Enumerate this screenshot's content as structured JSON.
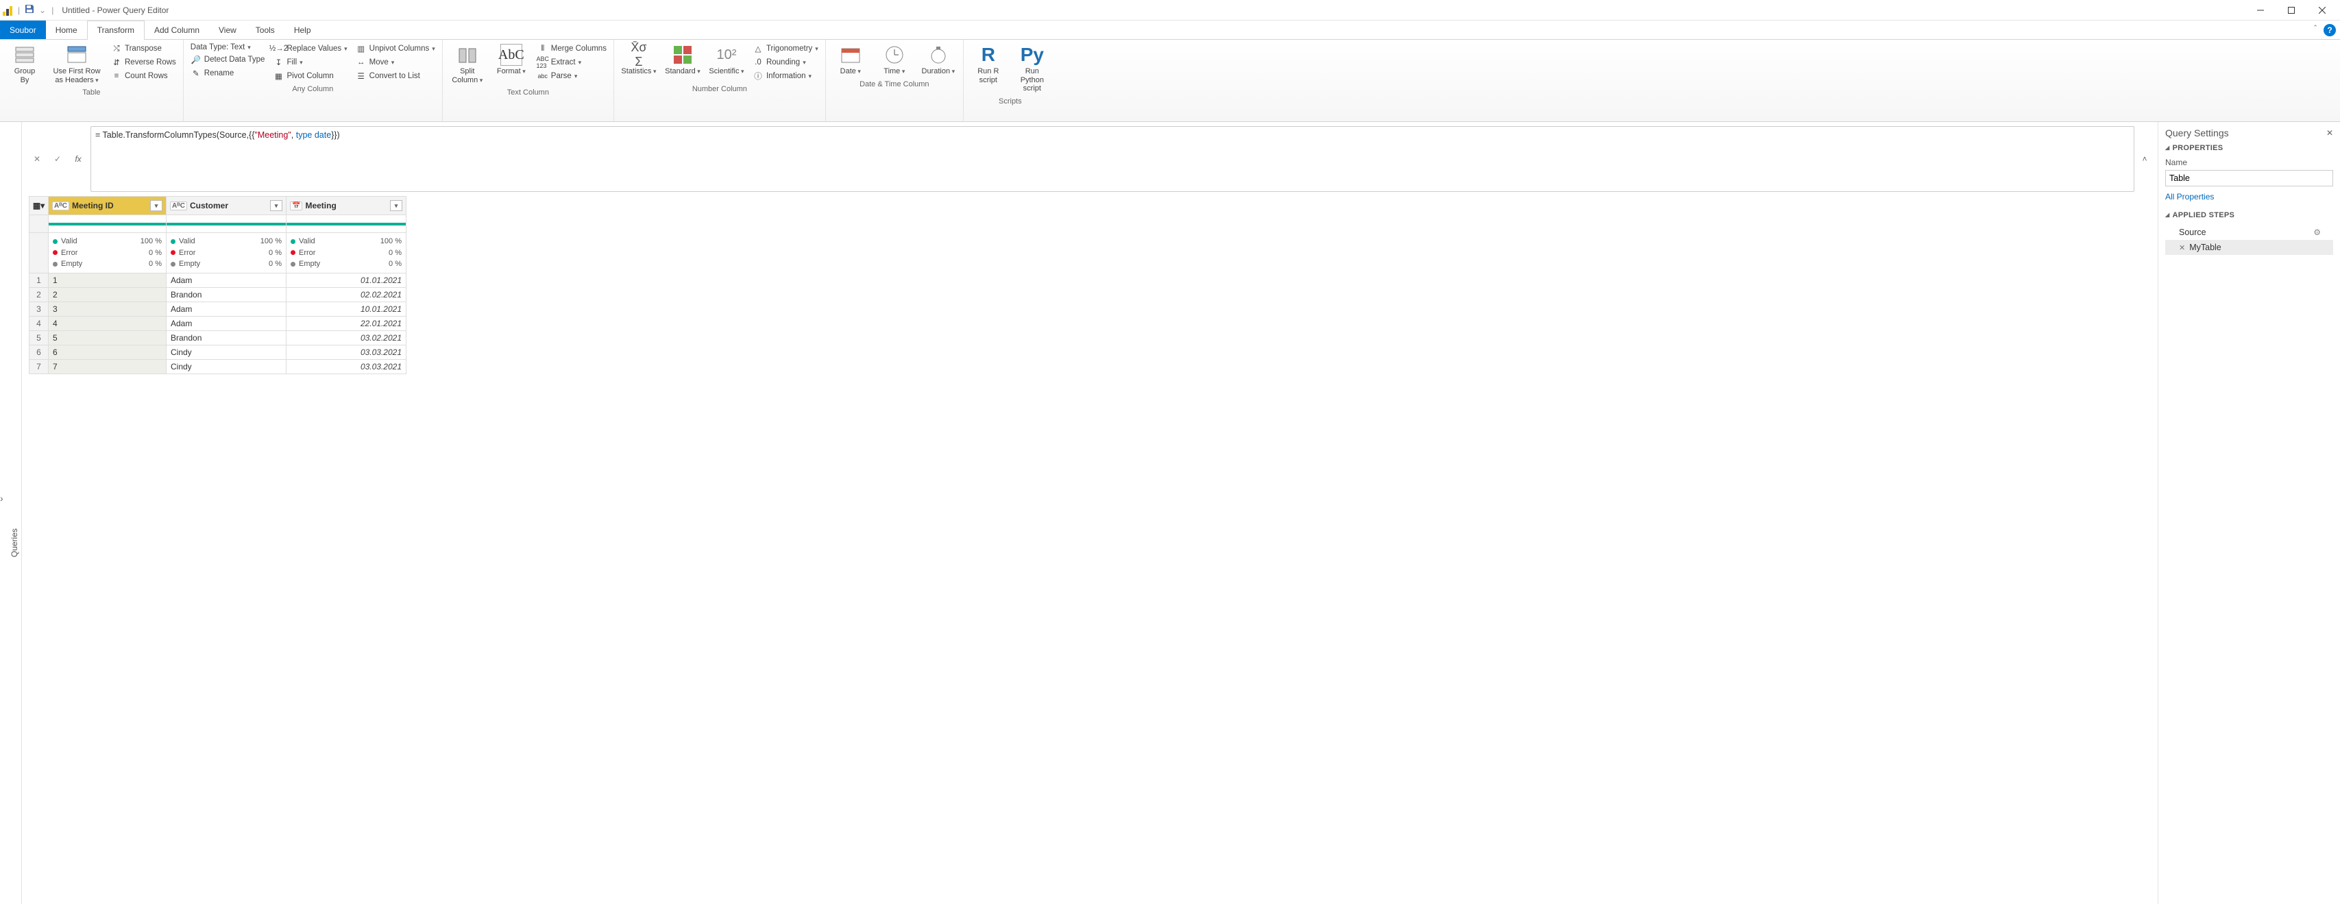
{
  "titlebar": {
    "title": "Untitled - Power Query Editor",
    "qat_dropdown": "⌄"
  },
  "tabs": {
    "file": "Soubor",
    "home": "Home",
    "transform": "Transform",
    "addcolumn": "Add Column",
    "view": "View",
    "tools": "Tools",
    "help": "Help"
  },
  "ribbon": {
    "table": {
      "label": "Table",
      "group_by": "Group\nBy",
      "use_first_row": "Use First Row\nas Headers",
      "transpose": "Transpose",
      "reverse_rows": "Reverse Rows",
      "count_rows": "Count Rows"
    },
    "any_column": {
      "label": "Any Column",
      "data_type": "Data Type: Text",
      "detect": "Detect Data Type",
      "rename": "Rename",
      "replace_values": "Replace Values",
      "fill": "Fill",
      "pivot": "Pivot Column",
      "unpivot": "Unpivot Columns",
      "move": "Move",
      "convert_to_list": "Convert to List"
    },
    "text_column": {
      "label": "Text Column",
      "split": "Split\nColumn",
      "format": "Format",
      "merge": "Merge Columns",
      "extract": "Extract",
      "parse": "Parse"
    },
    "number_column": {
      "label": "Number Column",
      "statistics": "Statistics",
      "standard": "Standard",
      "scientific": "Scientific",
      "trig": "Trigonometry",
      "rounding": "Rounding",
      "info": "Information"
    },
    "datetime_column": {
      "label": "Date & Time Column",
      "date": "Date",
      "time": "Time",
      "duration": "Duration"
    },
    "scripts": {
      "label": "Scripts",
      "r": "Run R\nscript",
      "py": "Run Python\nscript",
      "r_sym": "R",
      "py_sym": "Py"
    }
  },
  "queries_rail": {
    "label": "Queries",
    "chevron": "›"
  },
  "formula": {
    "prefix": "= Table.TransformColumnTypes(Source,{{",
    "str": "\"Meeting\"",
    "mid": ", ",
    "kw1": "type",
    "sp": " ",
    "kw2": "date",
    "suffix": "}})"
  },
  "grid": {
    "columns": [
      {
        "type_badge": "AᴮC",
        "name": "Meeting ID",
        "selected": true
      },
      {
        "type_badge": "AᴮC",
        "name": "Customer",
        "selected": false
      },
      {
        "type_badge": "📅",
        "name": "Meeting",
        "selected": false
      }
    ],
    "quality": {
      "valid_label": "Valid",
      "valid_pct": "100 %",
      "error_label": "Error",
      "error_pct": "0 %",
      "empty_label": "Empty",
      "empty_pct": "0 %"
    },
    "rows": [
      {
        "n": "1",
        "id": "1",
        "customer": "Adam",
        "meeting": "01.01.2021"
      },
      {
        "n": "2",
        "id": "2",
        "customer": "Brandon",
        "meeting": "02.02.2021"
      },
      {
        "n": "3",
        "id": "3",
        "customer": "Adam",
        "meeting": "10.01.2021"
      },
      {
        "n": "4",
        "id": "4",
        "customer": "Adam",
        "meeting": "22.01.2021"
      },
      {
        "n": "5",
        "id": "5",
        "customer": "Brandon",
        "meeting": "03.02.2021"
      },
      {
        "n": "6",
        "id": "6",
        "customer": "Cindy",
        "meeting": "03.03.2021"
      },
      {
        "n": "7",
        "id": "7",
        "customer": "Cindy",
        "meeting": "03.03.2021"
      }
    ]
  },
  "qsettings": {
    "title": "Query Settings",
    "properties_label": "PROPERTIES",
    "name_label": "Name",
    "name_value": "Table",
    "all_props": "All Properties",
    "applied_label": "APPLIED STEPS",
    "steps": [
      {
        "name": "Source",
        "selected": false,
        "gear": true,
        "x": false
      },
      {
        "name": "MyTable",
        "selected": true,
        "gear": false,
        "x": true
      }
    ]
  }
}
